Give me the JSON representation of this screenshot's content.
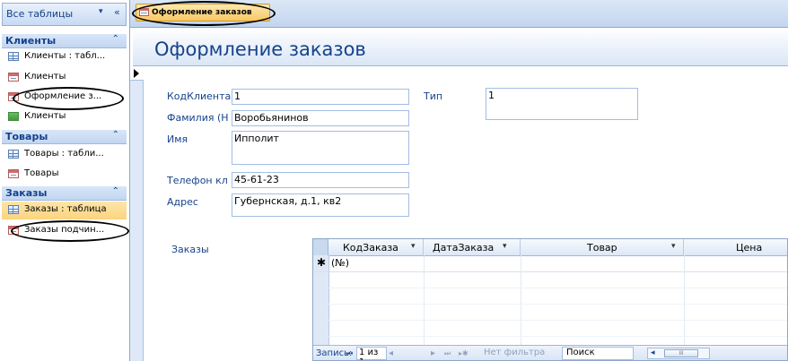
{
  "nav_pane": {
    "title": "Все таблицы",
    "dropdown_glyph": "▾",
    "collapse_glyph": "«",
    "groups": [
      {
        "label": "Клиенты",
        "chevron": "⌃",
        "items": [
          {
            "label": "Клиенты : табл...",
            "icon": "table-icon"
          },
          {
            "label": "Клиенты",
            "icon": "form-icon"
          },
          {
            "label": "Оформление з...",
            "icon": "form-icon"
          },
          {
            "label": "Клиенты",
            "icon": "report-icon"
          }
        ]
      },
      {
        "label": "Товары",
        "chevron": "⌃",
        "items": [
          {
            "label": "Товары : табли...",
            "icon": "table-icon"
          },
          {
            "label": "Товары",
            "icon": "form-icon"
          }
        ]
      },
      {
        "label": "Заказы",
        "chevron": "⌃",
        "items": [
          {
            "label": "Заказы : таблица",
            "icon": "table-icon"
          },
          {
            "label": "Заказы подчин...",
            "icon": "form-icon"
          }
        ]
      }
    ]
  },
  "document_tab": {
    "label": "Оформление заказов"
  },
  "form": {
    "title": "Оформление заказов",
    "fields": {
      "client_id": {
        "label": "КодКлиента",
        "value": "1"
      },
      "type": {
        "label": "Тип",
        "value": "1"
      },
      "surname": {
        "label": "Фамилия (Н",
        "value": "Воробьянинов"
      },
      "name": {
        "label": "Имя",
        "value": "Ипполит"
      },
      "phone": {
        "label": "Телефон кл",
        "value": "45-61-23"
      },
      "address": {
        "label": "Адрес",
        "value": "Губернская, д.1, кв2"
      }
    },
    "subform_label": "Заказы"
  },
  "datasheet": {
    "columns": [
      {
        "label": "КодЗаказа",
        "dropdown": "▾"
      },
      {
        "label": "ДатаЗаказа",
        "dropdown": "▾"
      },
      {
        "label": "Товар",
        "dropdown": "▾"
      },
      {
        "label": "Цена",
        "dropdown": ""
      }
    ],
    "new_row": {
      "marker": "✱",
      "value": "(№)"
    }
  },
  "record_nav": {
    "record_label": "Запись:",
    "first": "⏮",
    "prev": "◂",
    "current": "1 из 1",
    "next": "▸",
    "last": "⏭",
    "new": "▸✱",
    "filter": "Нет фильтра",
    "search": "Поиск",
    "scroll_left": "◂",
    "thumb": "III"
  }
}
